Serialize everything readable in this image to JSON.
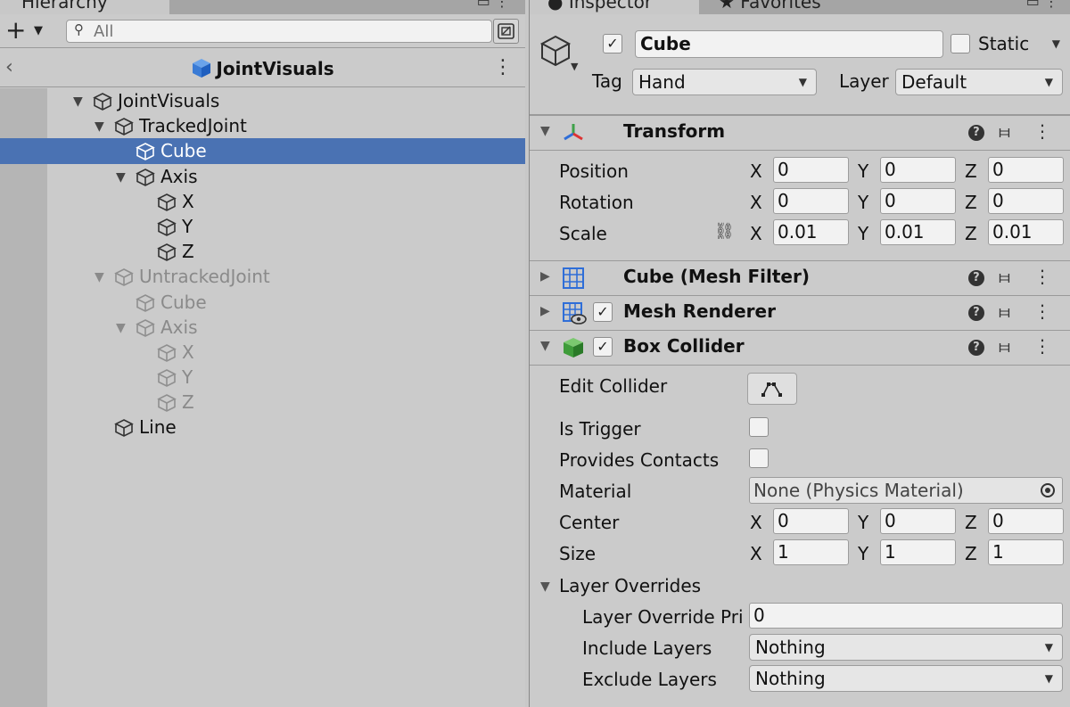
{
  "hierarchy": {
    "tab_title": "Hierarchy",
    "search_placeholder": "All",
    "breadcrumb_title": "JointVisuals",
    "rows": [
      {
        "label": "JointVisuals",
        "depth": 0,
        "expanded": true,
        "dim": false,
        "selected": false
      },
      {
        "label": "TrackedJoint",
        "depth": 1,
        "expanded": true,
        "dim": false,
        "selected": false
      },
      {
        "label": "Cube",
        "depth": 2,
        "expanded": null,
        "dim": false,
        "selected": true
      },
      {
        "label": "Axis",
        "depth": 2,
        "expanded": true,
        "dim": false,
        "selected": false
      },
      {
        "label": "X",
        "depth": 3,
        "expanded": null,
        "dim": false,
        "selected": false
      },
      {
        "label": "Y",
        "depth": 3,
        "expanded": null,
        "dim": false,
        "selected": false
      },
      {
        "label": "Z",
        "depth": 3,
        "expanded": null,
        "dim": false,
        "selected": false
      },
      {
        "label": "UntrackedJoint",
        "depth": 1,
        "expanded": true,
        "dim": true,
        "selected": false
      },
      {
        "label": "Cube",
        "depth": 2,
        "expanded": null,
        "dim": true,
        "selected": false
      },
      {
        "label": "Axis",
        "depth": 2,
        "expanded": true,
        "dim": true,
        "selected": false
      },
      {
        "label": "X",
        "depth": 3,
        "expanded": null,
        "dim": true,
        "selected": false
      },
      {
        "label": "Y",
        "depth": 3,
        "expanded": null,
        "dim": true,
        "selected": false
      },
      {
        "label": "Z",
        "depth": 3,
        "expanded": null,
        "dim": true,
        "selected": false
      },
      {
        "label": "Line",
        "depth": 1,
        "expanded": null,
        "dim": false,
        "selected": false
      }
    ]
  },
  "inspector": {
    "tab_title": "Inspector",
    "tab2_title": "Favorites",
    "object_name": "Cube",
    "active": true,
    "static_label": "Static",
    "static": false,
    "tag_label": "Tag",
    "tag_value": "Hand",
    "layer_label": "Layer",
    "layer_value": "Default",
    "transform": {
      "name": "Transform",
      "position_label": "Position",
      "rotation_label": "Rotation",
      "scale_label": "Scale",
      "position": {
        "x": "0",
        "y": "0",
        "z": "0"
      },
      "rotation": {
        "x": "0",
        "y": "0",
        "z": "0"
      },
      "scale": {
        "x": "0.01",
        "y": "0.01",
        "z": "0.01"
      }
    },
    "mesh_filter": {
      "name": "Cube (Mesh Filter)"
    },
    "mesh_renderer": {
      "name": "Mesh Renderer",
      "enabled": true
    },
    "box_collider": {
      "name": "Box Collider",
      "enabled": true,
      "edit_collider_label": "Edit Collider",
      "is_trigger_label": "Is Trigger",
      "provides_contacts_label": "Provides Contacts",
      "material_label": "Material",
      "material_value": "None (Physics Material)",
      "center_label": "Center",
      "size_label": "Size",
      "center": {
        "x": "0",
        "y": "0",
        "z": "0"
      },
      "size": {
        "x": "1",
        "y": "1",
        "z": "1"
      },
      "layer_overrides_label": "Layer Overrides",
      "layer_override_priority_label": "Layer Override Pri",
      "layer_override_priority_value": "0",
      "include_layers_label": "Include Layers",
      "include_layers_value": "Nothing",
      "exclude_layers_label": "Exclude Layers",
      "exclude_layers_value": "Nothing"
    },
    "axis_labels": {
      "x": "X",
      "y": "Y",
      "z": "Z"
    }
  },
  "colors": {
    "selection": "#4a72b3",
    "panel": "#cbcbcb",
    "field": "#f2f2f2"
  },
  "icons": {
    "gameobject": "cube-outline-icon",
    "prefab": "blue-cube-icon",
    "transform": "transform-axes-icon",
    "mesh_filter": "grid-icon",
    "mesh_renderer": "grid-eye-icon",
    "box_collider": "green-cube-icon"
  }
}
